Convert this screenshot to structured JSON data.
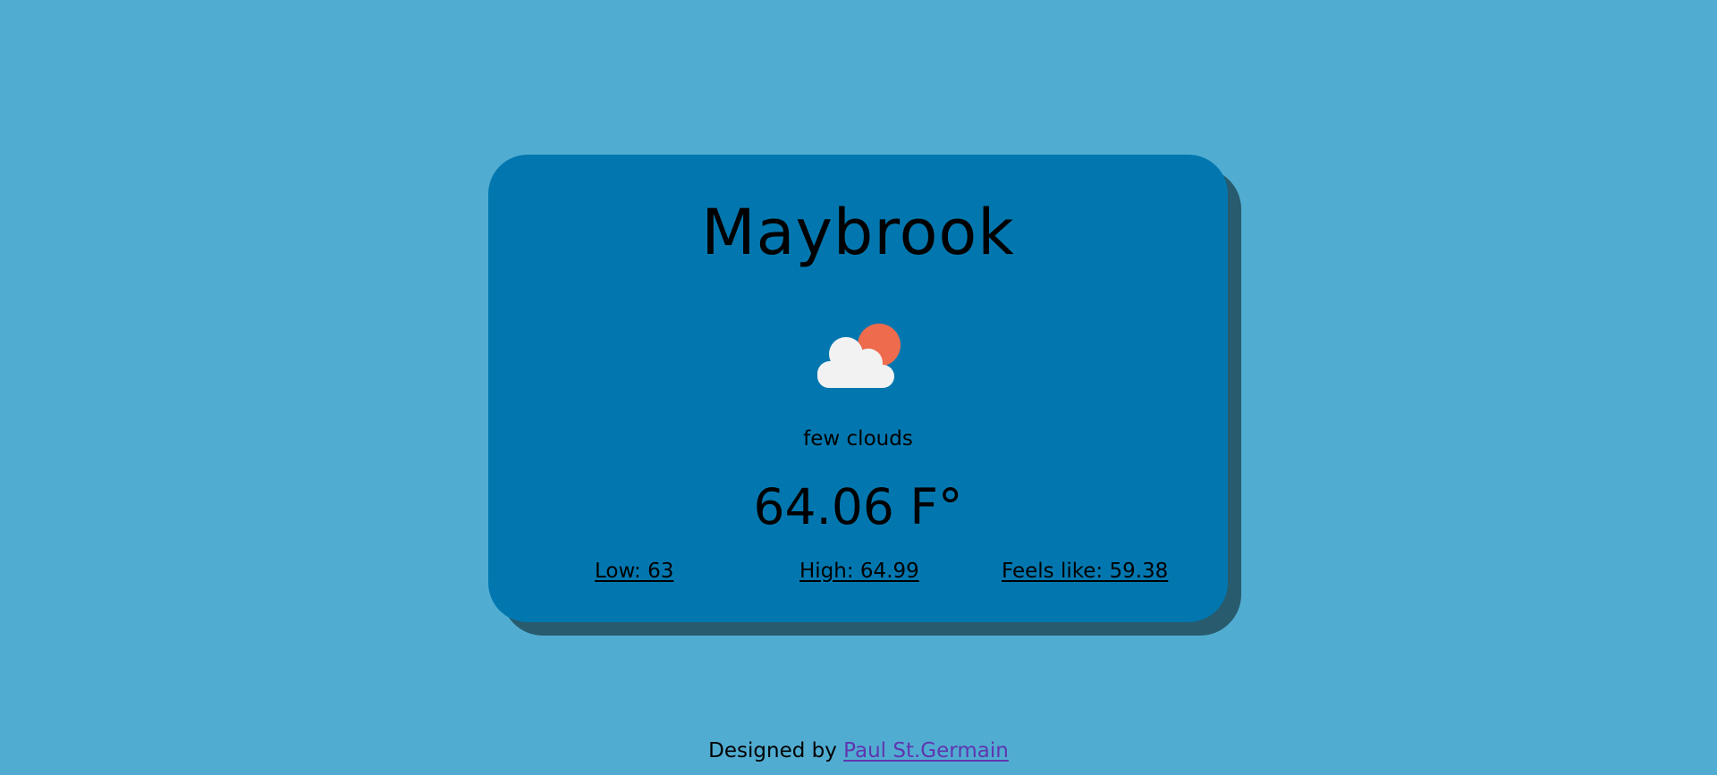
{
  "card": {
    "city": "Maybrook",
    "weather_icon": "few-clouds-icon",
    "description": "few clouds",
    "temperature": "64.06 F°",
    "low": "Low: 63",
    "high": "High: 64.99",
    "feels_like": "Feels like: 59.38"
  },
  "footer": {
    "prefix": "Designed by ",
    "author_link": "Paul St.Germain"
  },
  "colors": {
    "background": "#51acd1",
    "card": "#0277af",
    "card_shadow": "#275b6d",
    "sun": "#ee6b4d",
    "cloud": "#f2f2f2",
    "link": "#5f36b0"
  }
}
